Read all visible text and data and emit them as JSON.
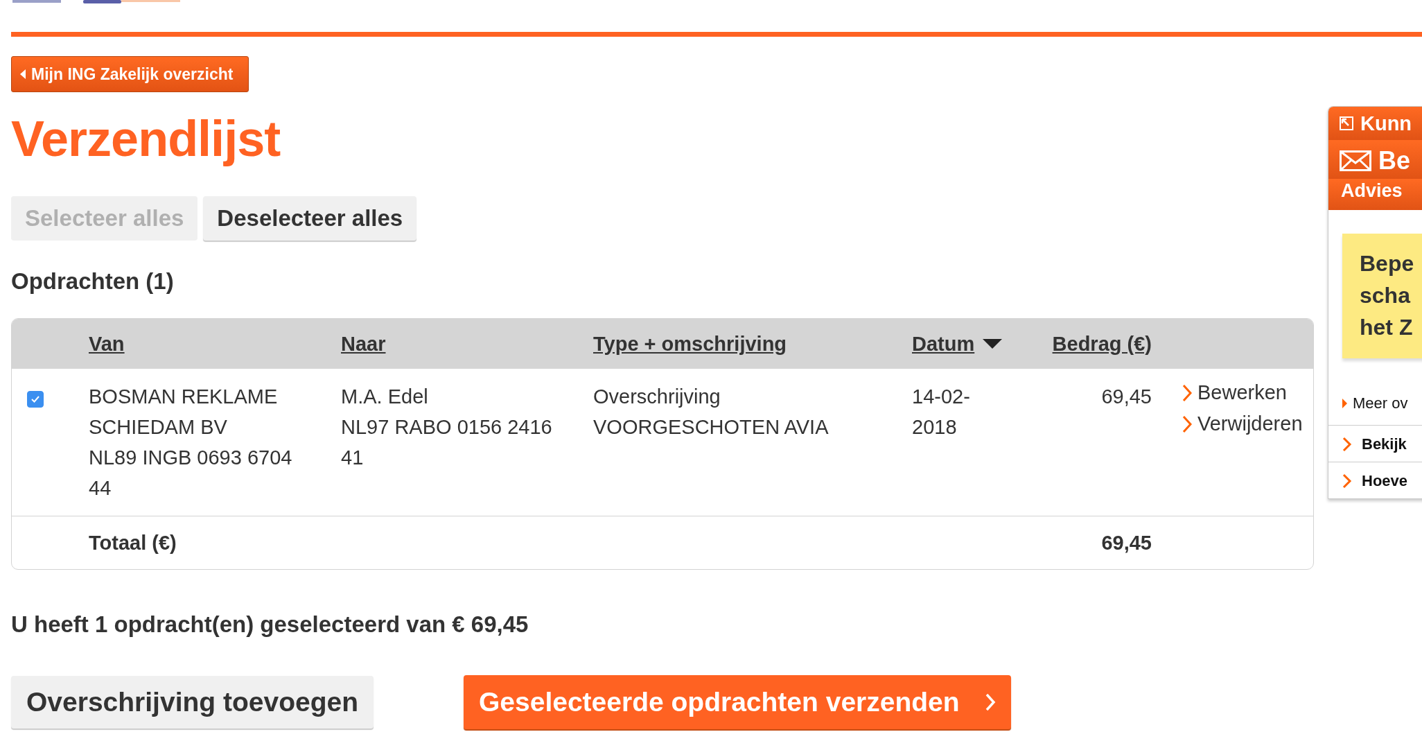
{
  "back_button": {
    "label": "Mijn ING Zakelijk overzicht"
  },
  "title": "Verzendlijst",
  "selection_buttons": [
    {
      "label": "Selecteer alles",
      "disabled": true
    },
    {
      "label": "Deselecteer alles",
      "disabled": false
    }
  ],
  "section_title": "Opdrachten (1)",
  "table": {
    "columns": [
      {
        "label": "Van",
        "sorted": false
      },
      {
        "label": "Naar",
        "sorted": false
      },
      {
        "label": "Type + omschrijving",
        "sorted": false
      },
      {
        "label": "Datum",
        "sorted": true
      },
      {
        "label": "Bedrag (€)",
        "sorted": false
      }
    ],
    "rows": [
      {
        "checked": true,
        "van": [
          "BOSMAN REKLAME",
          "SCHIEDAM BV",
          "NL89 INGB 0693 6704",
          "44"
        ],
        "naar": [
          "M.A. Edel",
          "NL97 RABO 0156 2416",
          "41"
        ],
        "type": [
          "Overschrijving",
          "VOORGESCHOTEN AVIA"
        ],
        "datum": [
          "14-02-",
          "2018"
        ],
        "bedrag": "69,45",
        "actions": [
          "Bewerken",
          "Verwijderen"
        ]
      }
    ],
    "total_label": "Totaal (€)",
    "total": "69,45"
  },
  "summary": "U heeft 1 opdracht(en) geselecteerd van € 69,45",
  "bottom_buttons": [
    {
      "label": "Overschrijving toevoegen",
      "kind": "secondary"
    },
    {
      "label": "Geselecteerde opdrachten verzenden",
      "kind": "primary"
    }
  ],
  "sidebar": {
    "header_items": [
      {
        "label": "Kunn",
        "kind": "external"
      },
      {
        "label": "Be",
        "kind": "mail"
      }
    ],
    "advies": "Advies",
    "note_lines": [
      "Bepe",
      "scha",
      "het Z"
    ],
    "more_link": "Meer ov",
    "links": [
      "Bekijk",
      "Hoeve"
    ]
  }
}
